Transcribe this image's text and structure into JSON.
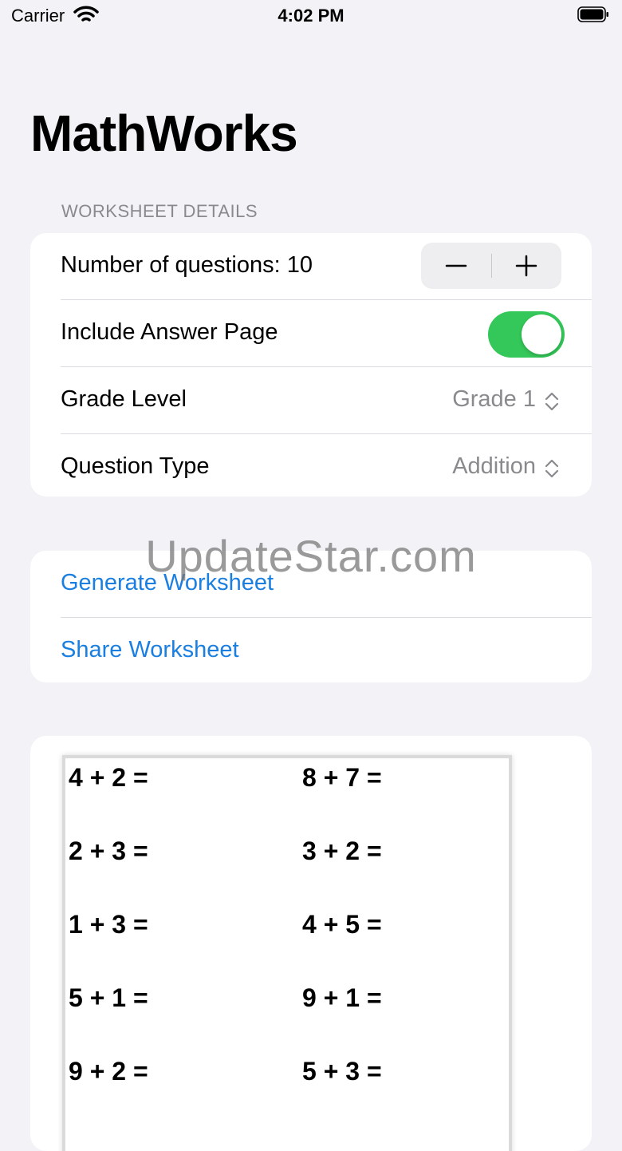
{
  "status_bar": {
    "carrier": "Carrier",
    "time": "4:02 PM"
  },
  "app": {
    "title": "MathWorks"
  },
  "worksheet_details": {
    "header": "WORKSHEET DETAILS",
    "questions_label": "Number of questions: 10",
    "answer_page_label": "Include Answer Page",
    "answer_page_on": true,
    "grade_label": "Grade Level",
    "grade_value": "Grade 1",
    "type_label": "Question Type",
    "type_value": "Addition"
  },
  "actions": {
    "generate_label": "Generate Worksheet",
    "share_label": "Share Worksheet"
  },
  "watermark": "UpdateStar.com",
  "worksheet_preview": {
    "left_column": [
      "4 + 2 =",
      "2 + 3 =",
      "1 + 3 =",
      "5 + 1 =",
      "9 + 2 ="
    ],
    "right_column": [
      "8 + 7 =",
      "3 + 2 =",
      "4 + 5 =",
      "9 + 1 =",
      "5 + 3 ="
    ]
  },
  "colors": {
    "accent": "#1a7fe0",
    "toggle_on": "#34c759",
    "background": "#f2f2f7",
    "secondary_text": "#8a8a8e"
  },
  "icons": {
    "wifi": "wifi-icon",
    "battery": "battery-icon",
    "minus": "minus-icon",
    "plus": "plus-icon",
    "chevrons": "chevron-up-down-icon"
  }
}
